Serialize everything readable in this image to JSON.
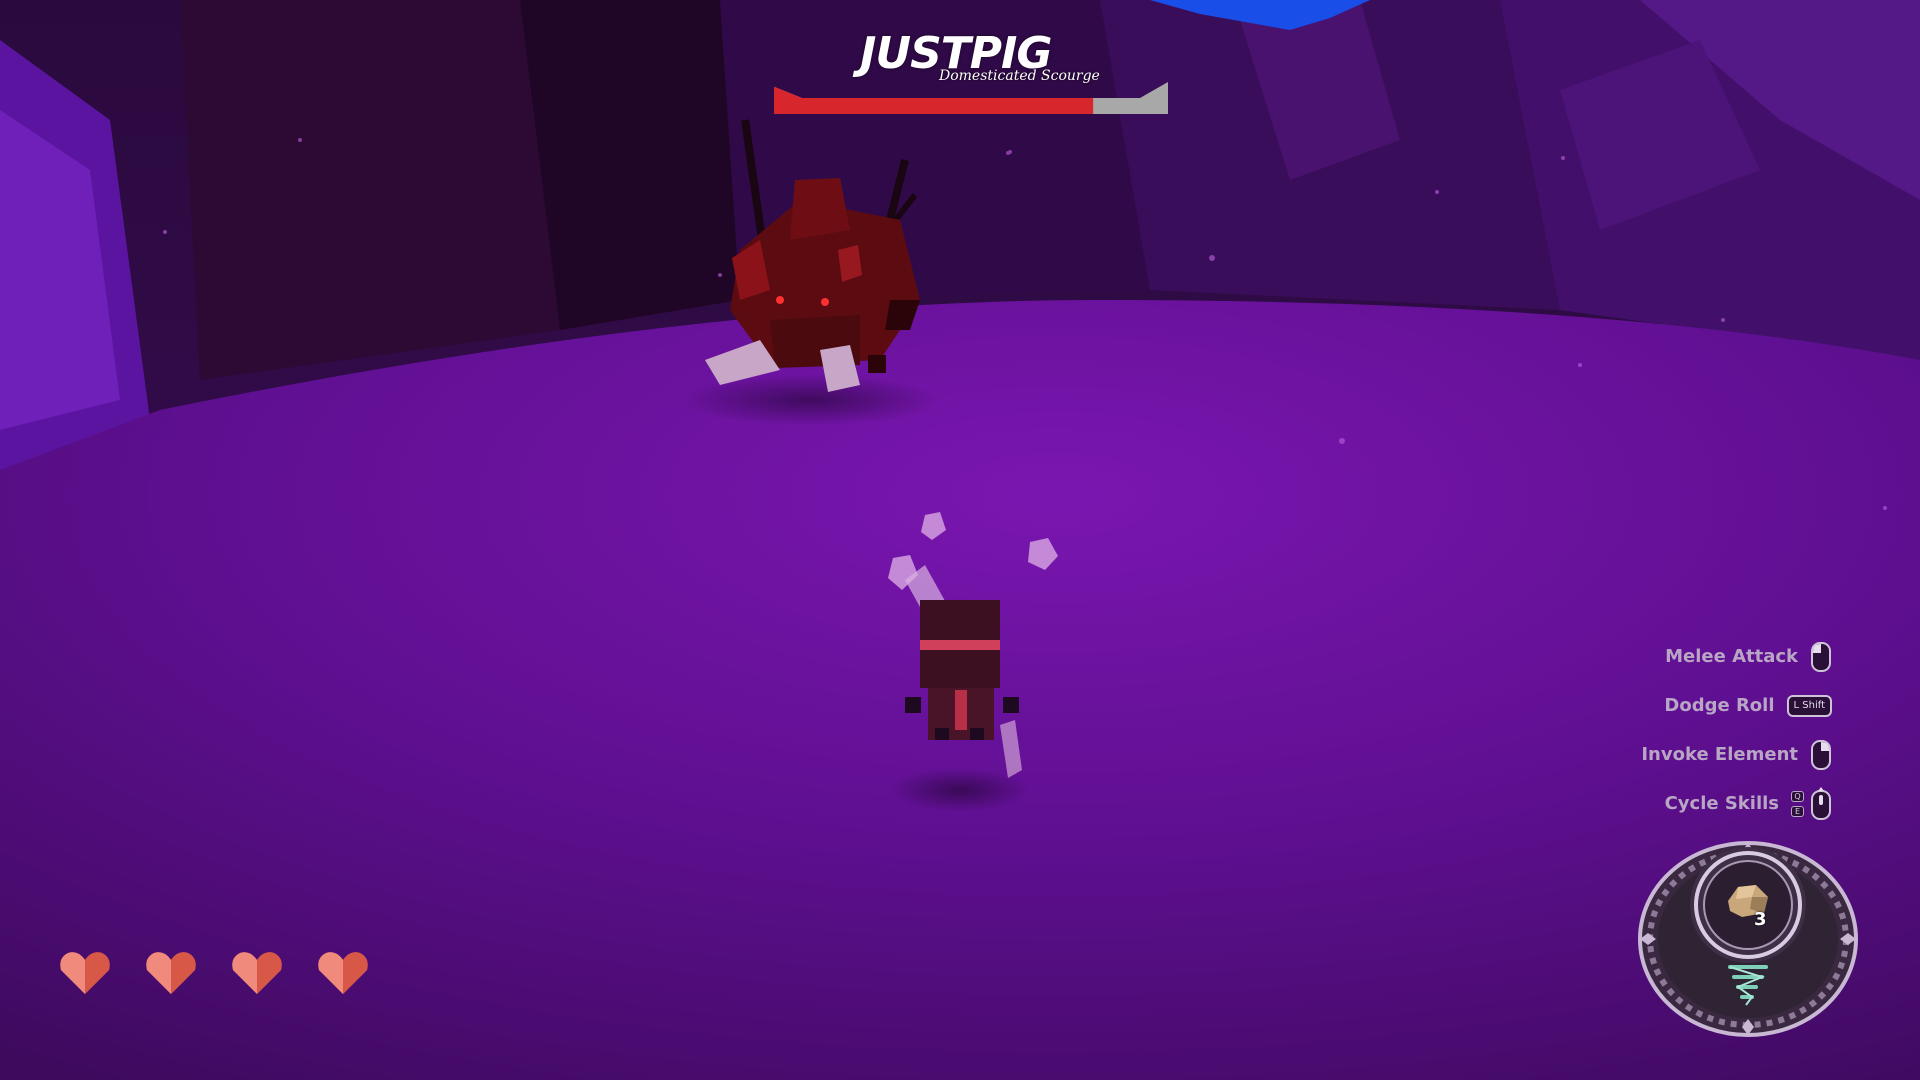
{
  "boss": {
    "name": "JUSTPIG",
    "subtitle": "Domesticated Scourge",
    "health_fraction": 0.81,
    "bar_fill_color": "#d8262d",
    "bar_empty_color": "#a8a8a8"
  },
  "controls": [
    {
      "label": "Melee Attack",
      "icon": "mouse-left-click-icon"
    },
    {
      "label": "Dodge Roll",
      "icon": "keyboard-key-icon",
      "key": "L Shift"
    },
    {
      "label": "Invoke Element",
      "icon": "mouse-right-click-icon"
    },
    {
      "label": "Cycle Skills",
      "icon": "mouse-scroll-icon",
      "keys": [
        "Q",
        "E"
      ]
    }
  ],
  "player": {
    "hearts": 4,
    "heart_color": "#e86a5e"
  },
  "skill": {
    "selected_icon": "rock-icon",
    "count": "3",
    "secondary_icon": "tornado-icon"
  }
}
